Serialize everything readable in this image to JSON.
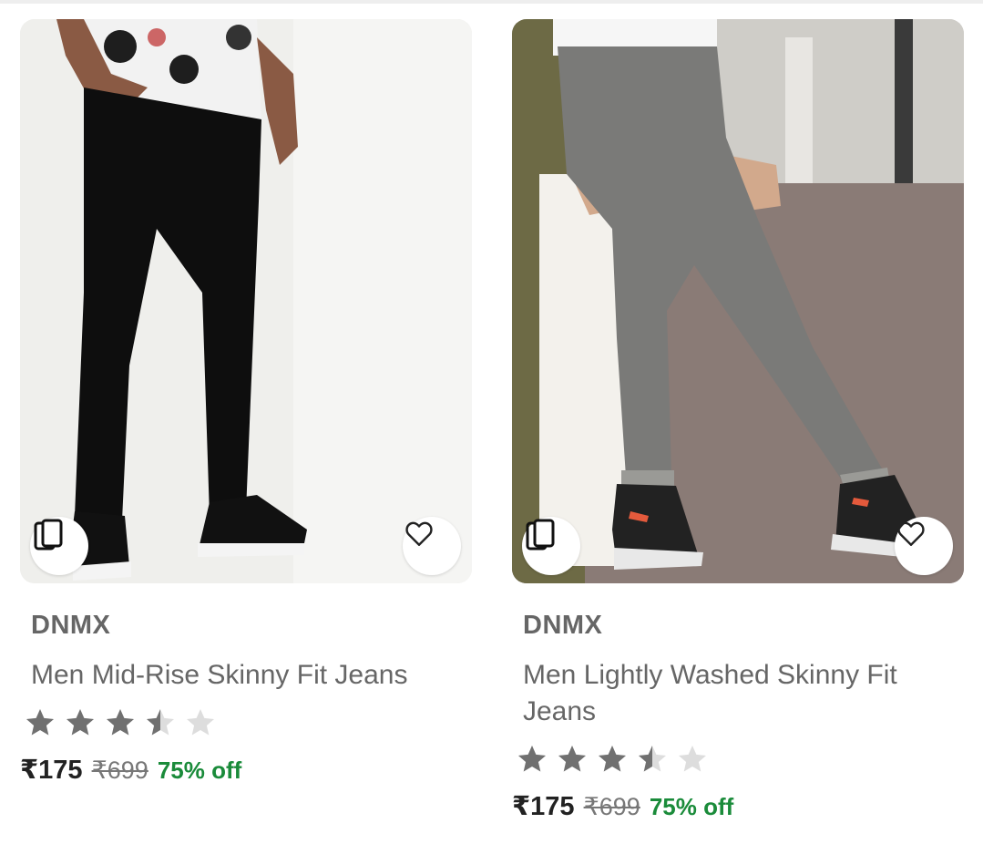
{
  "products": [
    {
      "brand": "DNMX",
      "name": "Men Mid-Rise Skinny Fit Jeans",
      "rating": 3.5,
      "rating_max": 5,
      "price": "₹175",
      "mrp": "₹699",
      "discount": "75% off",
      "image_desc": "black-jeans-photo",
      "icons": [
        "similar-products-icon",
        "heart-icon"
      ]
    },
    {
      "brand": "DNMX",
      "name": "Men Lightly Washed Skinny Fit Jeans",
      "rating": 3.5,
      "rating_max": 5,
      "price": "₹175",
      "mrp": "₹699",
      "discount": "75% off",
      "image_desc": "grey-jeans-photo",
      "icons": [
        "similar-products-icon",
        "heart-icon"
      ]
    }
  ],
  "colors": {
    "discount": "#1a8b3a",
    "star_filled": "#707070",
    "star_empty": "#dddddd"
  }
}
